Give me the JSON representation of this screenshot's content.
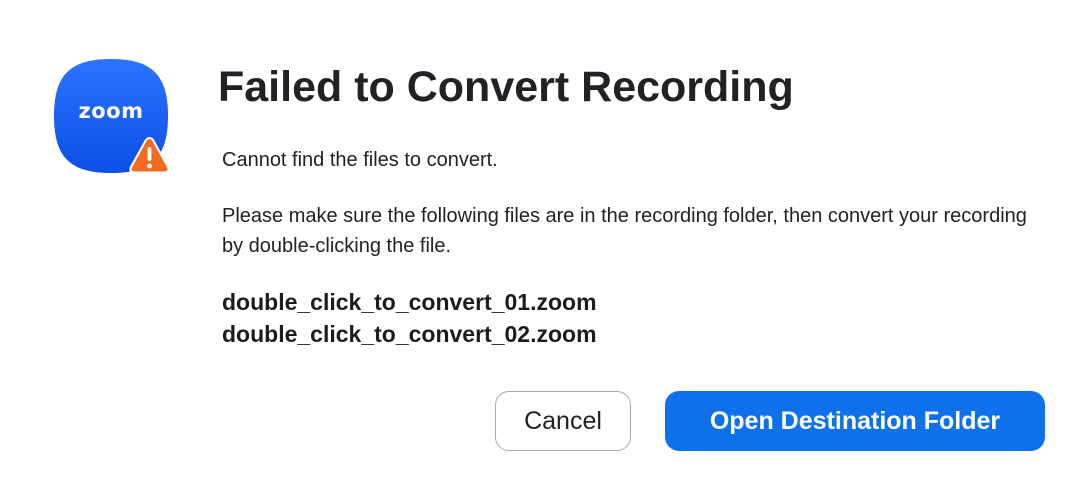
{
  "dialog": {
    "app_icon": {
      "name": "zoom-app-icon",
      "wordmark": "zoom",
      "badge": "warning-icon",
      "colors": {
        "icon_blue": "#0b5cff",
        "warning_orange": "#f26b21"
      }
    },
    "title": "Failed to Convert Recording",
    "message_line_1": "Cannot find the files to convert.",
    "message_line_2": "Please make sure the following files are in the recording folder, then convert your recording by double-clicking the file.",
    "files": [
      "double_click_to_convert_01.zoom",
      "double_click_to_convert_02.zoom"
    ],
    "buttons": {
      "cancel_label": "Cancel",
      "primary_label": "Open Destination Folder"
    },
    "colors": {
      "primary_button": "#0e71eb",
      "text": "#222222"
    }
  }
}
